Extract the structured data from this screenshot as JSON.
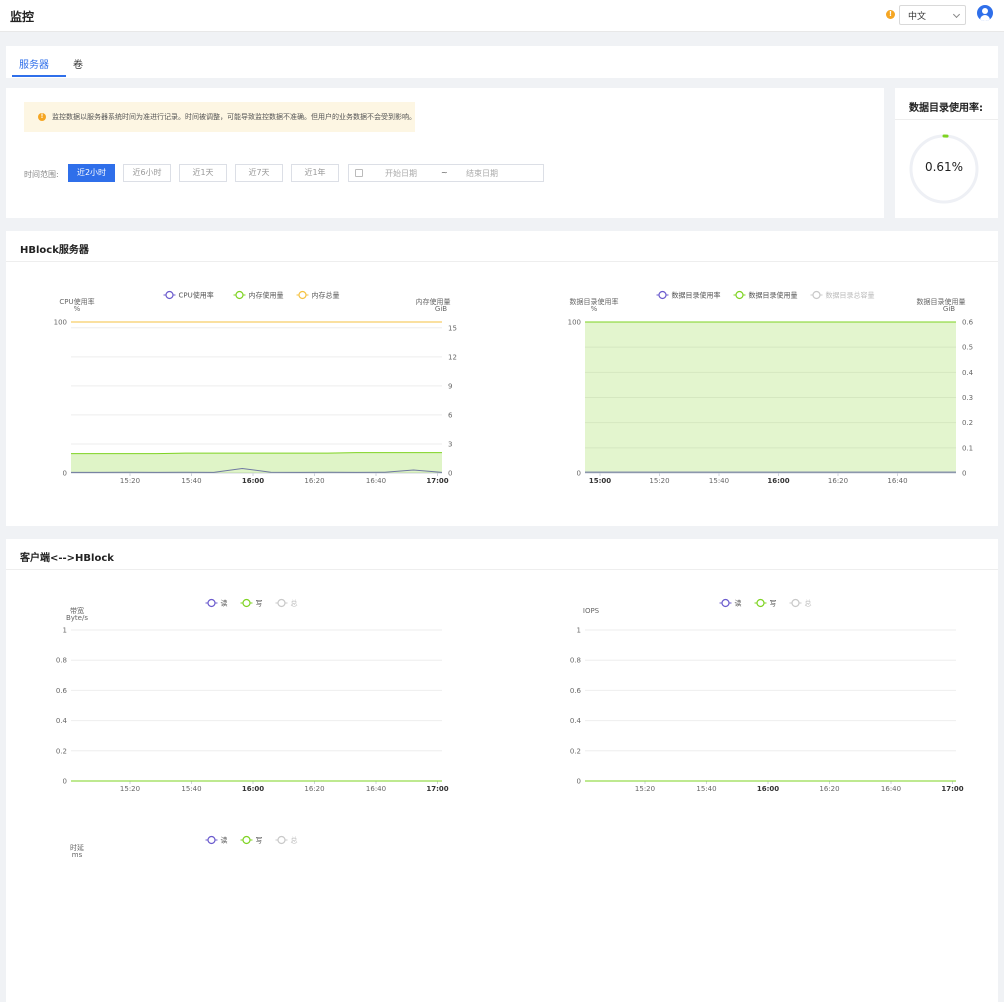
{
  "header": {
    "title": "监控",
    "language": "中文"
  },
  "tabs": [
    {
      "label": "服务器",
      "active": true
    },
    {
      "label": "卷",
      "active": false
    }
  ],
  "notice": "监控数据以服务器系统时间为准进行记录。时间被调整，可能导致监控数据不准确。但用户的业务数据不会受到影响。",
  "filter": {
    "label": "时间范围:",
    "ranges": [
      "近2小时",
      "近6小时",
      "近1天",
      "近7天",
      "近1年"
    ],
    "active_index": 0,
    "start_placeholder": "开始日期",
    "separator": "~",
    "end_placeholder": "结束日期"
  },
  "usage": {
    "title": "数据目录使用率:",
    "value_text": "0.61%",
    "value": 0.61
  },
  "sections": [
    {
      "title": "HBlock服务器"
    },
    {
      "title": "客户端<-->HBlock"
    }
  ],
  "colors": {
    "primary": "#2f6fea",
    "cpu": "#6a5acd",
    "mem_used": "#7ed321",
    "mem_total": "#f5c242",
    "disabled": "#c8c8c8"
  },
  "chart_data": [
    {
      "type": "line",
      "legend": [
        "CPU使用率",
        "内存使用量",
        "内存总量"
      ],
      "y_left_label": "CPU使用率",
      "y_left_unit": "%",
      "y_right_label": "内存使用量",
      "y_right_unit": "GiB",
      "x_ticks": [
        "15:20",
        "15:40",
        "16:00",
        "16:20",
        "16:40",
        "17:00"
      ],
      "y_left_ticks": [
        "100",
        "0"
      ],
      "y_right_ticks": [
        "15",
        "12",
        "9",
        "6",
        "3",
        "0"
      ],
      "ylim_left": [
        0,
        100
      ],
      "ylim_right": [
        0,
        15.6
      ],
      "series": [
        {
          "name": "CPU使用率",
          "axis": "left",
          "values": [
            0.4,
            0.4,
            0.5,
            0.4,
            0.5,
            0.4,
            3,
            0.5,
            0.4,
            0.5,
            0.4,
            0.5,
            2,
            0.4
          ]
        },
        {
          "name": "内存使用量",
          "axis": "right",
          "values": [
            2.0,
            2.0,
            2.0,
            2.0,
            2.05,
            2.05,
            2.05,
            2.05,
            2.05,
            2.05,
            2.1,
            2.1,
            2.1,
            2.1
          ]
        },
        {
          "name": "内存总量",
          "axis": "right",
          "values": [
            15.6,
            15.6
          ]
        }
      ]
    },
    {
      "type": "area",
      "legend": [
        "数据目录使用率",
        "数据目录使用量",
        "数据目录总容量"
      ],
      "y_left_label": "数据目录使用率",
      "y_left_unit": "%",
      "y_right_label": "数据目录使用量",
      "y_right_unit": "GiB",
      "x_ticks": [
        "15:00",
        "15:20",
        "15:40",
        "16:00",
        "16:20",
        "16:40"
      ],
      "y_left_ticks": [
        "100",
        "0"
      ],
      "y_right_ticks": [
        "0.6",
        "0.5",
        "0.4",
        "0.3",
        "0.2",
        "0.1",
        "0"
      ],
      "ylim_left": [
        0,
        100
      ],
      "ylim_right": [
        0,
        0.6
      ],
      "series": [
        {
          "name": "数据目录使用率",
          "axis": "left",
          "values": [
            0.61,
            0.61
          ]
        },
        {
          "name": "数据目录使用量",
          "axis": "right",
          "values": [
            0.6,
            0.6
          ]
        }
      ]
    },
    {
      "type": "line",
      "legend": [
        "读",
        "写",
        "总"
      ],
      "y_left_label": "带宽",
      "y_left_unit": "Byte/s",
      "x_ticks": [
        "15:20",
        "15:40",
        "16:00",
        "16:20",
        "16:40",
        "17:00"
      ],
      "y_left_ticks": [
        "1",
        "0.8",
        "0.6",
        "0.4",
        "0.2",
        "0"
      ],
      "ylim_left": [
        0,
        1
      ],
      "series": [
        {
          "name": "读",
          "values": [
            0,
            0
          ]
        },
        {
          "name": "写",
          "values": [
            0,
            0
          ]
        }
      ]
    },
    {
      "type": "line",
      "legend": [
        "读",
        "写",
        "总"
      ],
      "y_left_label": "IOPS",
      "y_left_unit": "",
      "x_ticks": [
        "15:20",
        "15:40",
        "16:00",
        "16:20",
        "16:40",
        "17:00"
      ],
      "y_left_ticks": [
        "1",
        "0.8",
        "0.6",
        "0.4",
        "0.2",
        "0"
      ],
      "ylim_left": [
        0,
        1
      ],
      "series": [
        {
          "name": "读",
          "values": [
            0,
            0
          ]
        },
        {
          "name": "写",
          "values": [
            0,
            0
          ]
        }
      ]
    },
    {
      "type": "line",
      "legend": [
        "读",
        "写",
        "总"
      ],
      "y_left_label": "时延",
      "y_left_unit": "ms",
      "series": []
    }
  ]
}
